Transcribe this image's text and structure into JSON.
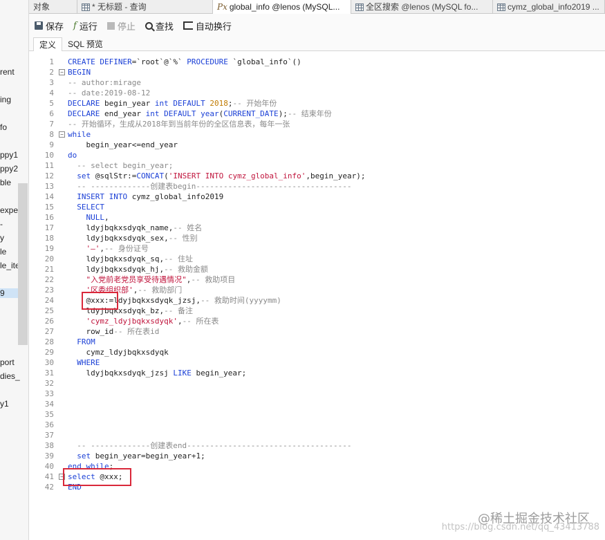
{
  "side_items": [
    {
      "label": "rent"
    },
    {
      "label": "ing"
    },
    {
      "label": "fo"
    },
    {
      "label": "ppy1"
    },
    {
      "label": "ppy2"
    },
    {
      "label": "ble"
    },
    {
      "label": "expe"
    },
    {
      "label": "-"
    },
    {
      "label": "y"
    },
    {
      "label": "le"
    },
    {
      "label": "le_ite"
    },
    {
      "label": "9"
    },
    {
      "label": "port"
    },
    {
      "label": "dies_"
    },
    {
      "label": "y1"
    }
  ],
  "tabs": [
    {
      "label": "对象",
      "icon": "none"
    },
    {
      "label": "* 无标题 - 查询",
      "icon": "grid-icon"
    },
    {
      "label": "global_info @lenos (MySQL...",
      "icon": "procedure-icon"
    },
    {
      "label": "全区搜索 @lenos (MySQL fo...",
      "icon": "grid-icon"
    },
    {
      "label": "cymz_global_info2019 ...",
      "icon": "grid-icon"
    }
  ],
  "toolbar": {
    "save": "保存",
    "run": "运行",
    "stop": "停止",
    "find": "查找",
    "wrap": "自动换行"
  },
  "subtabs": {
    "definition": "定义",
    "sql_preview": "SQL 预览"
  },
  "watermark": {
    "line1": "@稀土掘金技术社区",
    "line2": "https://blog.csdn.net/qq_43413788"
  },
  "code_lines": [
    {
      "n": "1",
      "text": "CREATE DEFINER=`root`@`%` PROCEDURE `global_info`()"
    },
    {
      "n": "2",
      "text": "BEGIN"
    },
    {
      "n": "3",
      "text": "-- author:mirage"
    },
    {
      "n": "4",
      "text": "-- date:2019-08-12"
    },
    {
      "n": "5",
      "text": "DECLARE begin_year int DEFAULT 2018;-- 开始年份"
    },
    {
      "n": "6",
      "text": "DECLARE end_year int DEFAULT year(CURRENT_DATE);-- 结束年份"
    },
    {
      "n": "7",
      "text": "-- 开始循环，生成从2018年到当前年份的全区信息表，每年一张"
    },
    {
      "n": "8",
      "text": "while"
    },
    {
      "n": "9",
      "text": "    begin_year<=end_year"
    },
    {
      "n": "10",
      "text": "do"
    },
    {
      "n": "11",
      "text": "  -- select begin_year;"
    },
    {
      "n": "12",
      "text": "  set @sqlStr:=CONCAT('INSERT INTO cymz_global_info',begin_year);"
    },
    {
      "n": "13",
      "text": "  -- -------------创建表begin----------------------------------"
    },
    {
      "n": "14",
      "text": "  INSERT INTO cymz_global_info2019"
    },
    {
      "n": "15",
      "text": "  SELECT"
    },
    {
      "n": "16",
      "text": "    NULL,"
    },
    {
      "n": "17",
      "text": "    ldyjbqkxsdyqk_name,-- 姓名"
    },
    {
      "n": "18",
      "text": "    ldyjbqkxsdyqk_sex,-- 性别"
    },
    {
      "n": "19",
      "text": "    '—',-- 身份证号"
    },
    {
      "n": "20",
      "text": "    ldyjbqkxsdyqk_sq,-- 住址"
    },
    {
      "n": "21",
      "text": "    ldyjbqkxsdyqk_hj,-- 救助金额"
    },
    {
      "n": "22",
      "text": "    \"入党前老党员享受待遇情况\",-- 救助项目"
    },
    {
      "n": "23",
      "text": "    '区委组织部',-- 救助部门"
    },
    {
      "n": "24",
      "text": "    @xxx:=ldyjbqkxsdyqk_jzsj,-- 救助时间(yyyymm)"
    },
    {
      "n": "25",
      "text": "    ldyjbqkxsdyqk_bz,-- 备注"
    },
    {
      "n": "26",
      "text": "    'cymz_ldyjbqkxsdyqk',-- 所在表"
    },
    {
      "n": "27",
      "text": "    row_id-- 所在表id"
    },
    {
      "n": "28",
      "text": "  FROM"
    },
    {
      "n": "29",
      "text": "    cymz_ldyjbqkxsdyqk"
    },
    {
      "n": "30",
      "text": "  WHERE"
    },
    {
      "n": "31",
      "text": "    ldyjbqkxsdyqk_jzsj LIKE begin_year;"
    },
    {
      "n": "32",
      "text": ""
    },
    {
      "n": "33",
      "text": ""
    },
    {
      "n": "34",
      "text": ""
    },
    {
      "n": "35",
      "text": ""
    },
    {
      "n": "36",
      "text": ""
    },
    {
      "n": "37",
      "text": ""
    },
    {
      "n": "38",
      "text": "  -- -------------创建表end------------------------------------"
    },
    {
      "n": "39",
      "text": "  set begin_year=begin_year+1;"
    },
    {
      "n": "40",
      "text": "end while;"
    },
    {
      "n": "41",
      "text": "select @xxx;"
    },
    {
      "n": "42",
      "text": "END"
    }
  ],
  "colors": {
    "keyword": "#1a3fd6",
    "string": "#c0143c",
    "number": "#c07a00",
    "comment": "#8a8a8a",
    "highlight_box": "#d9283a"
  }
}
